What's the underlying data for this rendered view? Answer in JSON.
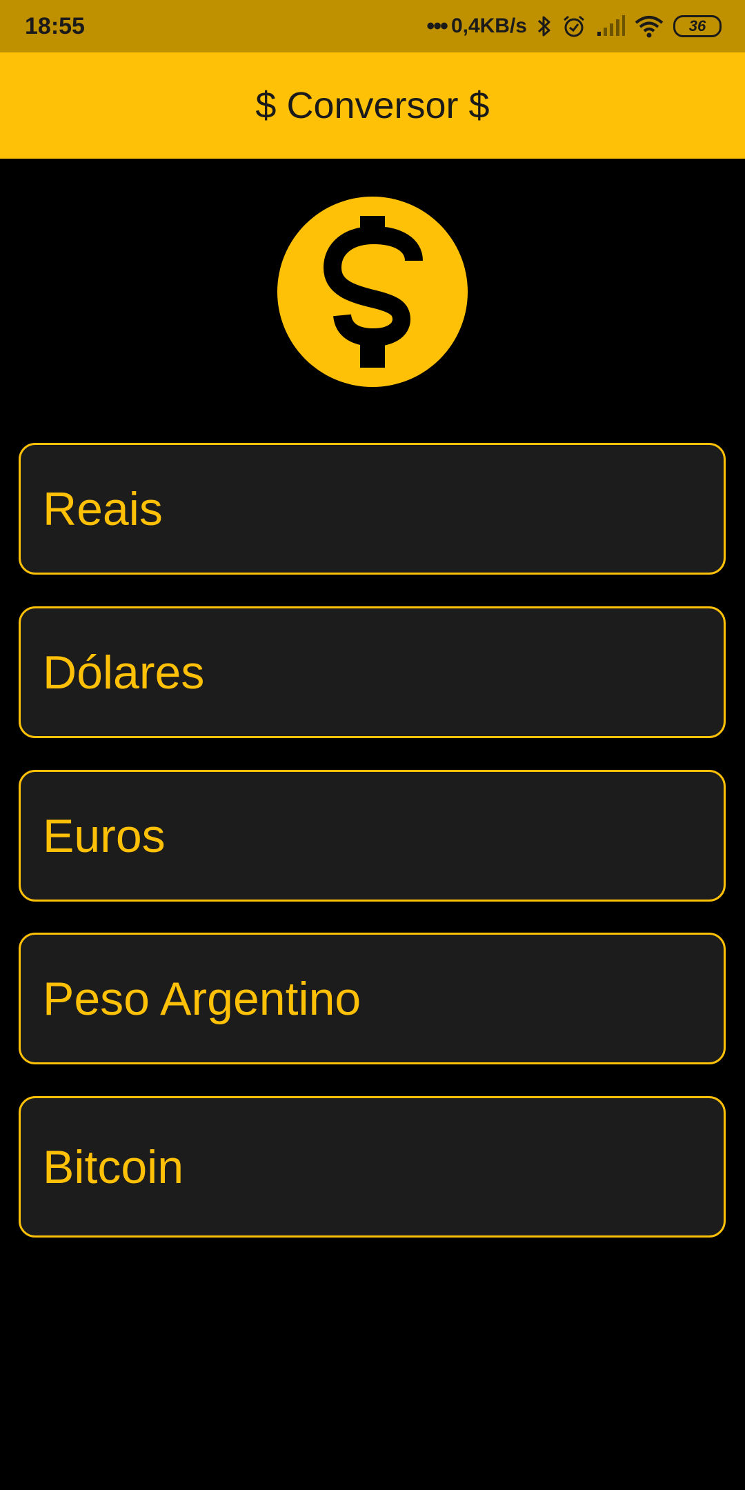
{
  "status_bar": {
    "time": "18:55",
    "dots": "•••",
    "speed": "0,4KB/s",
    "battery": "36",
    "icons": [
      "bluetooth-icon",
      "alarm-icon",
      "signal-icon",
      "wifi-icon",
      "battery-icon"
    ]
  },
  "app_bar": {
    "title": "$ Conversor $"
  },
  "logo": {
    "icon": "dollar-coin-icon"
  },
  "options": [
    {
      "label": "Reais"
    },
    {
      "label": "Dólares"
    },
    {
      "label": "Euros"
    },
    {
      "label": "Peso Argentino"
    },
    {
      "label": "Bitcoin"
    }
  ],
  "colors": {
    "accent": "#FFC107",
    "status_bar": "#BF9000",
    "background": "#000000",
    "card": "#1C1C1C"
  }
}
